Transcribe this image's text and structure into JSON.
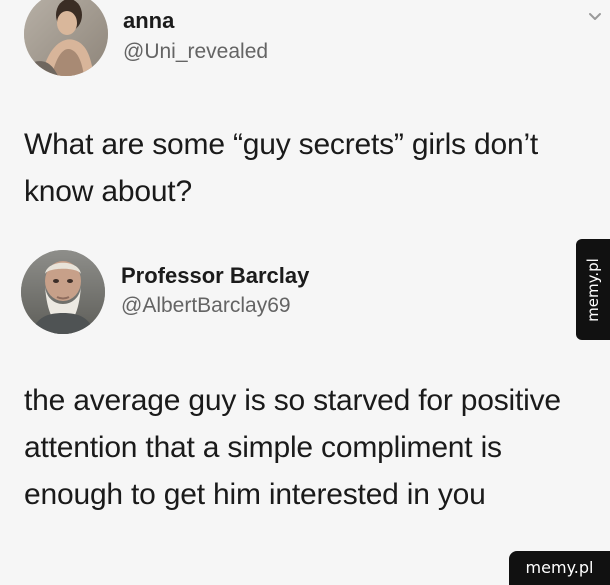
{
  "tweets": [
    {
      "author_name": "anna",
      "author_handle": "@Uni_revealed",
      "text": "What are some “guy secrets” girls don’t know about?"
    },
    {
      "author_name": "Professor Barclay",
      "author_handle": "@AlbertBarclay69",
      "text": "the average guy is so starved for positive attention that a simple compliment is enough to get him interested in you"
    }
  ],
  "watermarks": {
    "side": "memy.pl",
    "corner": "memy.pl"
  },
  "icons": {
    "top_right": "chevron-down-icon"
  }
}
